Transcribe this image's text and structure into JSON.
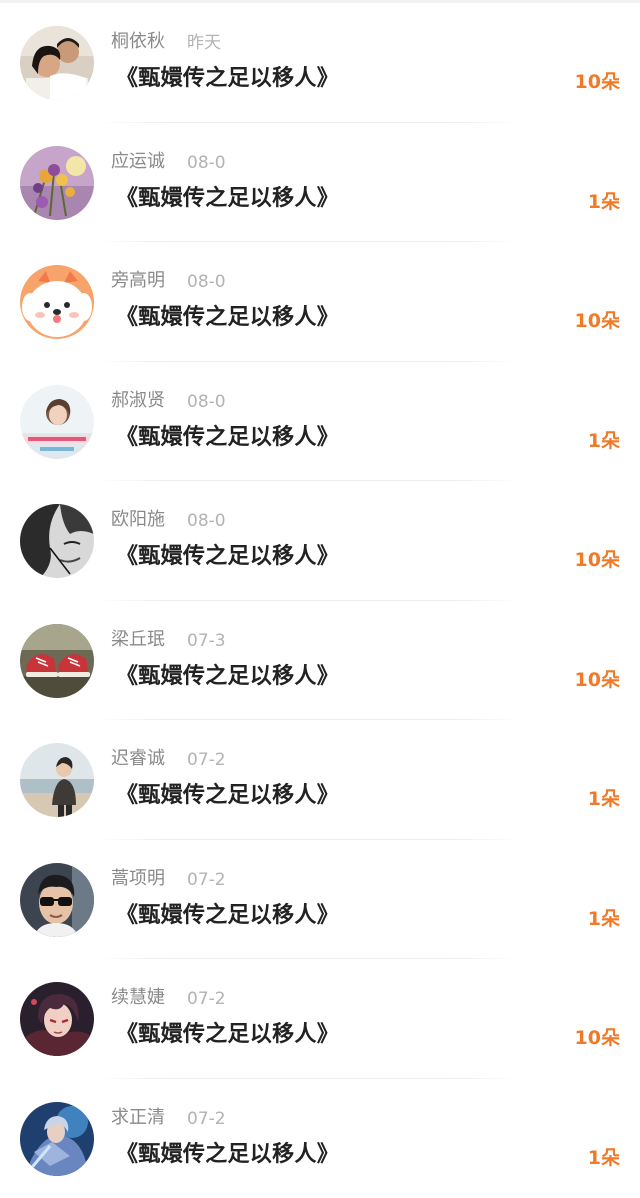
{
  "gifts": {
    "items": [
      {
        "name": "桐依秋",
        "date": "昨天",
        "title": "《甄嬛传之足以移人》",
        "amount": "10朵",
        "avatar_icon": "couple-photo-avatar"
      },
      {
        "name": "应运诚",
        "date": "08-0",
        "title": "《甄嬛传之足以移人》",
        "amount": "1朵",
        "avatar_icon": "flowers-avatar"
      },
      {
        "name": "旁高明",
        "date": "08-0",
        "title": "《甄嬛传之足以移人》",
        "amount": "10朵",
        "avatar_icon": "cartoon-dog-avatar"
      },
      {
        "name": "郝淑贤",
        "date": "08-0",
        "title": "《甄嬛传之足以移人》",
        "amount": "1朵",
        "avatar_icon": "girl-with-caption-avatar"
      },
      {
        "name": "欧阳施",
        "date": "08-0",
        "title": "《甄嬛传之足以移人》",
        "amount": "10朵",
        "avatar_icon": "monochrome-face-avatar"
      },
      {
        "name": "梁丘珉",
        "date": "07-3",
        "title": "《甄嬛传之足以移人》",
        "amount": "10朵",
        "avatar_icon": "red-sneakers-avatar"
      },
      {
        "name": "迟睿诚",
        "date": "07-2",
        "title": "《甄嬛传之足以移人》",
        "amount": "1朵",
        "avatar_icon": "boy-on-beach-avatar"
      },
      {
        "name": "蒿项明",
        "date": "07-2",
        "title": "《甄嬛传之足以移人》",
        "amount": "1朵",
        "avatar_icon": "man-in-sunglasses-avatar"
      },
      {
        "name": "续慧婕",
        "date": "07-2",
        "title": "《甄嬛传之足以移人》",
        "amount": "10朵",
        "avatar_icon": "anime-character-avatar"
      },
      {
        "name": "求正清",
        "date": "07-2",
        "title": "《甄嬛传之足以移人》",
        "amount": "1朵",
        "avatar_icon": "game-hero-avatar"
      }
    ]
  },
  "colors": {
    "amount": "#f07a28",
    "name": "#8a8a8a",
    "date": "#b3b3b3",
    "title": "#222222"
  }
}
